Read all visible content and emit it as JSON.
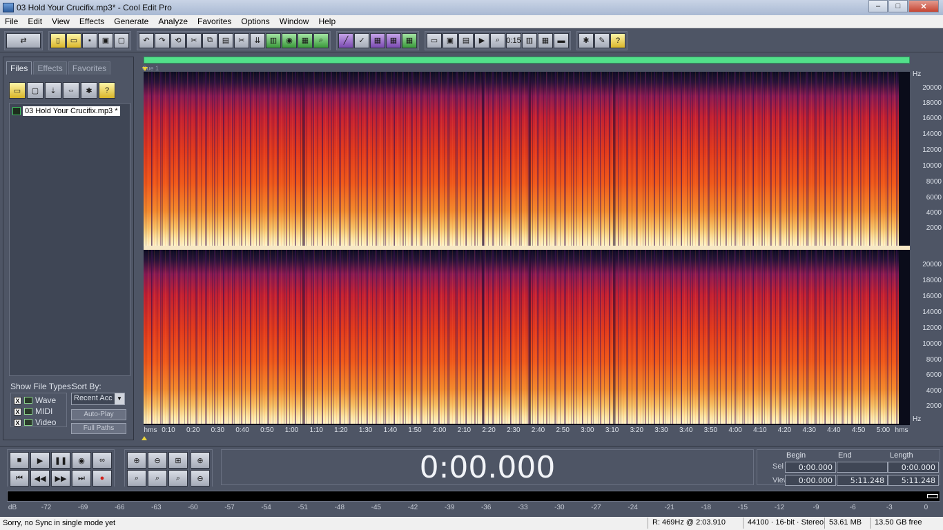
{
  "window": {
    "title": "03 Hold Your Crucifix.mp3* - Cool Edit Pro",
    "controls": {
      "minimize": "–",
      "maximize": "□",
      "close": "✕"
    }
  },
  "menu": [
    "File",
    "Edit",
    "View",
    "Effects",
    "Generate",
    "Analyze",
    "Favorites",
    "Options",
    "Window",
    "Help"
  ],
  "toolbar": {
    "icons": [
      "multitrack-icon",
      "new-icon",
      "open-icon",
      "save-icon",
      "save-all-icon",
      "close-file-icon",
      "undo-icon",
      "redo-icon",
      "repeat-icon",
      "cut-icon",
      "copy-icon",
      "paste-icon",
      "trim-icon",
      "mix-paste-icon",
      "loop-icon",
      "cd-icon",
      "scripts-icon",
      "filter-icon",
      "draw-icon",
      "grid-icon",
      "grid2-icon",
      "grid3-icon",
      "waveform-view-icon",
      "spectral-view-icon",
      "spectral-pitch-icon",
      "play-selection-icon",
      "zoom-in-icon",
      "time-format-icon",
      "cd-track-icon",
      "meter-icon",
      "hide-icon",
      "settings-icon",
      "tools-icon",
      "help-icon"
    ],
    "time_label": "0:15"
  },
  "left_panel": {
    "tabs": [
      "Files",
      "Effects",
      "Favorites"
    ],
    "active_tab": "Files",
    "files": [
      {
        "name": "03 Hold Your Crucifix.mp3 *"
      }
    ],
    "show_file_types_label": "Show File Types:",
    "sort_by_label": "Sort By:",
    "file_types": [
      {
        "label": "Wave",
        "checked": "X"
      },
      {
        "label": "MIDI",
        "checked": "X"
      },
      {
        "label": "Video",
        "checked": "X"
      }
    ],
    "sort_value": "Recent Acc",
    "auto_play_label": "Auto-Play",
    "full_paths_label": "Full Paths"
  },
  "display": {
    "cue_label": "Cue 1",
    "hz_unit": "Hz",
    "freq_ticks": [
      "20000",
      "18000",
      "16000",
      "14000",
      "12000",
      "10000",
      "8000",
      "6000",
      "4000",
      "2000"
    ],
    "time_ticks": [
      "hms",
      "0:10",
      "0:20",
      "0:30",
      "0:40",
      "0:50",
      "1:00",
      "1:10",
      "1:20",
      "1:30",
      "1:40",
      "1:50",
      "2:00",
      "2:10",
      "2:20",
      "2:30",
      "2:40",
      "2:50",
      "3:00",
      "3:10",
      "3:20",
      "3:30",
      "3:40",
      "3:50",
      "4:00",
      "4:10",
      "4:20",
      "4:30",
      "4:40",
      "4:50",
      "5:00",
      "hms"
    ],
    "accent_color": "#52e08a"
  },
  "transport": {
    "time": "0:00.000",
    "buttons_row1": [
      "stop-icon",
      "play-icon",
      "pause-icon",
      "play-to-end-icon",
      "loop-play-icon"
    ],
    "buttons_row2": [
      "go-start-icon",
      "rewind-icon",
      "fast-forward-icon",
      "go-end-icon",
      "record-icon"
    ]
  },
  "selection": {
    "headers": {
      "begin": "Begin",
      "end": "End",
      "length": "Length"
    },
    "sel_label": "Sel",
    "view_label": "View",
    "sel": {
      "begin": "0:00.000",
      "end": "",
      "length": "0:00.000"
    },
    "view": {
      "begin": "0:00.000",
      "end": "5:11.248",
      "length": "5:11.248"
    }
  },
  "meter": {
    "db_labels": [
      "dB",
      "-72",
      "-69",
      "-66",
      "-63",
      "-60",
      "-57",
      "-54",
      "-51",
      "-48",
      "-45",
      "-42",
      "-39",
      "-36",
      "-33",
      "-30",
      "-27",
      "-24",
      "-21",
      "-18",
      "-15",
      "-12",
      "-9",
      "-6",
      "-3",
      "0"
    ]
  },
  "status": {
    "message": "Sorry, no Sync in single mode yet",
    "cursor_info": "R: 469Hz @  2:03.910",
    "format": "44100 · 16-bit · Stereo",
    "size": "53.61 MB",
    "free": "13.50 GB free"
  }
}
